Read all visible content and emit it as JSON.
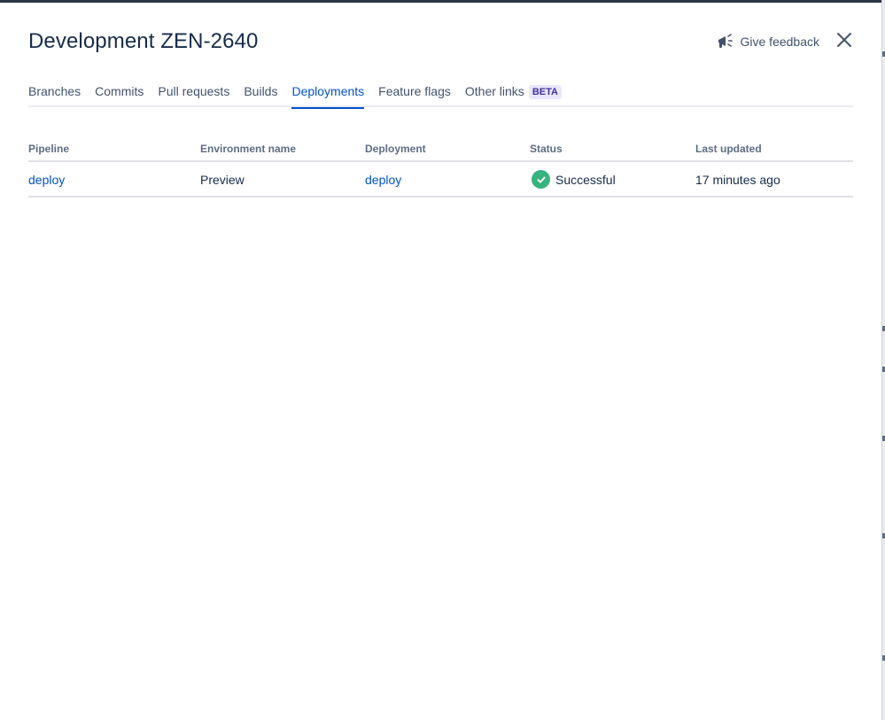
{
  "header": {
    "title": "Development ZEN-2640",
    "feedback_label": "Give feedback"
  },
  "tabs": [
    {
      "label": "Branches",
      "active": false
    },
    {
      "label": "Commits",
      "active": false
    },
    {
      "label": "Pull requests",
      "active": false
    },
    {
      "label": "Builds",
      "active": false
    },
    {
      "label": "Deployments",
      "active": true
    },
    {
      "label": "Feature flags",
      "active": false
    },
    {
      "label": "Other links",
      "badge": "BETA",
      "active": false
    }
  ],
  "table": {
    "headers": [
      "Pipeline",
      "Environment name",
      "Deployment",
      "Status",
      "Last updated"
    ],
    "rows": [
      {
        "pipeline": "deploy",
        "environment": "Preview",
        "deployment": "deploy",
        "status": "Successful",
        "last_updated": "17 minutes ago"
      }
    ]
  },
  "colors": {
    "accent": "#0052cc",
    "success": "#36b37e",
    "text": "#172b4d",
    "badge_bg": "#eae6ff",
    "badge_text": "#403294"
  }
}
